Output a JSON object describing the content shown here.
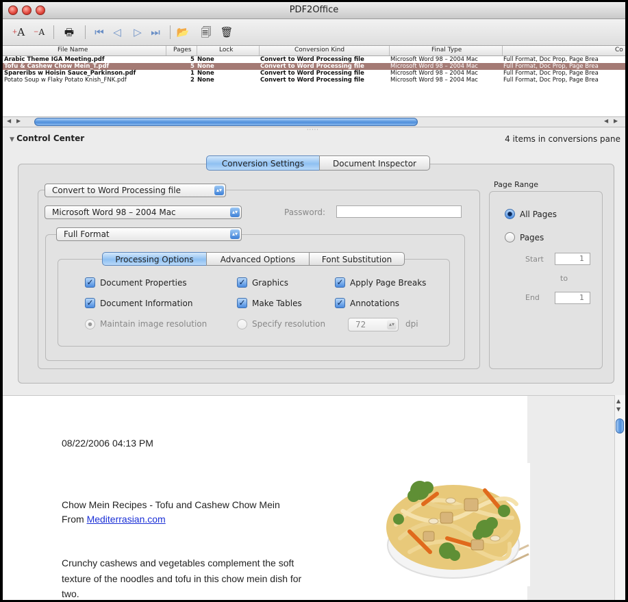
{
  "window": {
    "title": "PDF2Office"
  },
  "toolbar": {
    "font_increase": "A",
    "font_decrease": "A"
  },
  "file_list": {
    "columns": [
      "File Name",
      "Pages",
      "Lock",
      "Conversion Kind",
      "Final Type",
      "Co"
    ],
    "rows": [
      {
        "name": "Arabic Theme IGA Meeting.pdf",
        "pages": "5",
        "lock": "None",
        "kind": "Convert to Word Processing file",
        "final": "Microsoft Word 98 – 2004 Mac",
        "options": "Full Format, Doc Prop, Page Brea",
        "selected": false
      },
      {
        "name": "Tofu & Cashew Chow Mein_T.pdf",
        "pages": "5",
        "lock": "None",
        "kind": "Convert to Word Processing file",
        "final": "Microsoft Word 98 – 2004 Mac",
        "options": "Full Format, Doc Prop, Page Brea",
        "selected": true
      },
      {
        "name": "Spareribs w Hoisin Sauce_Parkinson.pdf",
        "pages": "1",
        "lock": "None",
        "kind": "Convert to Word Processing file",
        "final": "Microsoft Word 98 – 2004 Mac",
        "options": "Full Format, Doc Prop, Page Brea",
        "selected": false
      },
      {
        "name": "Potato Soup w Flaky Potato Knish_FNK.pdf",
        "pages": "2",
        "lock": "None",
        "kind": "Convert to Word Processing file",
        "final": "Microsoft Word 98 – 2004 Mac",
        "options": "Full Format, Doc Prop, Page Brea",
        "selected": false
      }
    ]
  },
  "control_center": {
    "title": "Control Center",
    "items_count": "4 items in conversions pane",
    "tabs": [
      "Conversion Settings",
      "Document Inspector"
    ],
    "conversion_kind": "Convert to Word Processing file",
    "final_type": "Microsoft Word 98 – 2004 Mac",
    "password_label": "Password:",
    "password_value": "",
    "format": "Full Format",
    "sub_tabs": [
      "Processing Options",
      "Advanced Options",
      "Font Substitution"
    ],
    "options": {
      "doc_properties": "Document Properties",
      "graphics": "Graphics",
      "page_breaks": "Apply Page Breaks",
      "doc_information": "Document Information",
      "make_tables": "Make Tables",
      "annotations": "Annotations",
      "maintain_res": "Maintain image resolution",
      "specify_res": "Specify resolution",
      "dpi_value": "72",
      "dpi_unit": "dpi"
    },
    "page_range": {
      "title": "Page Range",
      "all_pages": "All Pages",
      "pages": "Pages",
      "start_label": "Start",
      "start_value": "1",
      "to_label": "to",
      "end_label": "End",
      "end_value": "1"
    }
  },
  "preview": {
    "date": "08/22/2006 04:13 PM",
    "heading": "Chow Mein Recipes - Tofu and Cashew Chow Mein",
    "from_label": "From",
    "source_link": "Mediterrasian.com",
    "body_line1": "Crunchy cashews and vegetables complement the soft",
    "body_line2": "texture of the noodles and tofu in this chow mein dish for",
    "body_line3": "two."
  }
}
